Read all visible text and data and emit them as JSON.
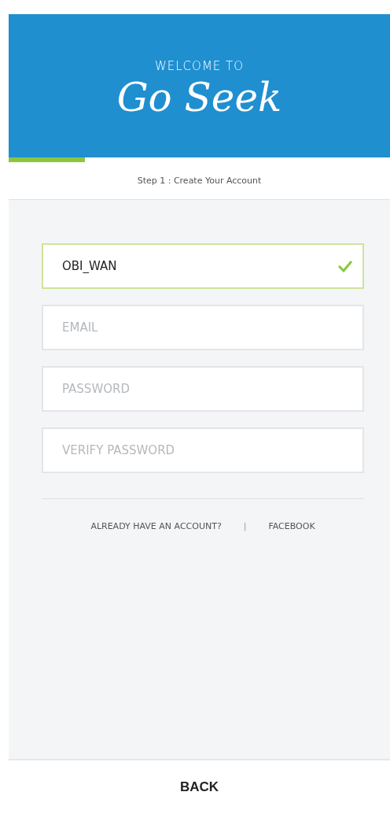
{
  "header": {
    "welcome": "WELCOME TO",
    "logo": "Go Seek"
  },
  "progress": {
    "level": 0.2
  },
  "step": "Step 1 : Create Your Account",
  "fields": [
    {
      "value": "OBI_WAN",
      "valid": true
    },
    {
      "placeholder": "EMAIL",
      "valid": false
    },
    {
      "placeholder": "PASSWORD",
      "valid": false
    },
    {
      "placeholder": "VERIFY PASSWORD",
      "valid": false
    }
  ],
  "links": [
    {
      "label": "ALREADY HAVE AN ACCOUNT?"
    },
    {
      "label": "FACEBOOK"
    }
  ],
  "separator": "|",
  "back_button": "BACK"
}
